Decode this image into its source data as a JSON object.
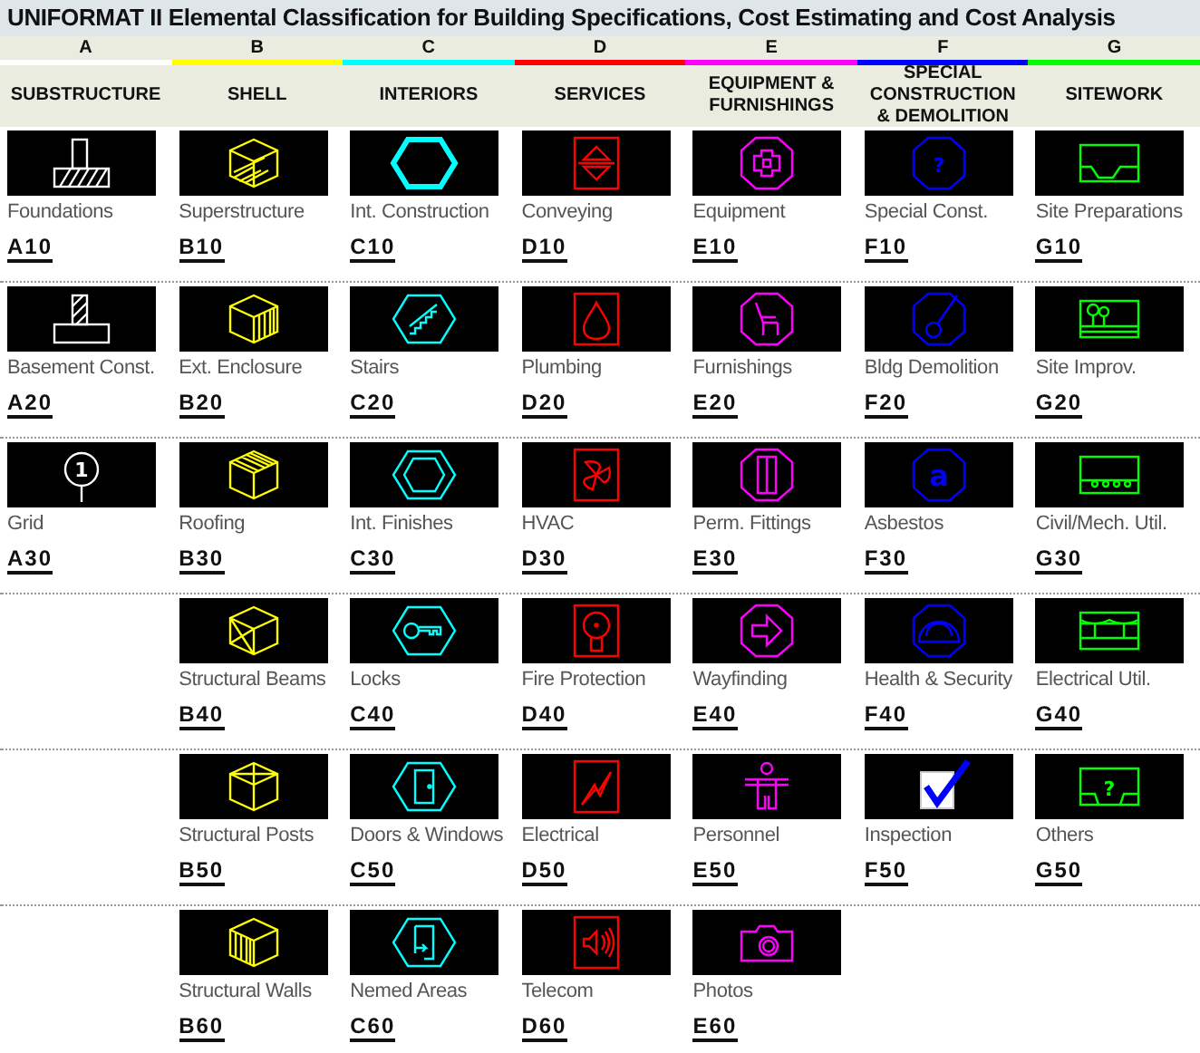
{
  "title": "UNIFORMAT II Elemental Classification for Building Specifications, Cost Estimating and Cost Analysis",
  "columns": [
    {
      "letter": "A",
      "heading": "SUBSTRUCTURE",
      "color": "#ffffff",
      "items": [
        {
          "label": "Foundations",
          "code": "A10"
        },
        {
          "label": "Basement Const.",
          "code": "A20"
        },
        {
          "label": "Grid",
          "code": "A30",
          "icon_text": "1"
        }
      ]
    },
    {
      "letter": "B",
      "heading": "SHELL",
      "color": "#ffff00",
      "items": [
        {
          "label": "Superstructure",
          "code": "B10"
        },
        {
          "label": "Ext. Enclosure",
          "code": "B20"
        },
        {
          "label": "Roofing",
          "code": "B30"
        },
        {
          "label": "Structural Beams",
          "code": "B40"
        },
        {
          "label": "Structural Posts",
          "code": "B50"
        },
        {
          "label": "Structural Walls",
          "code": "B60"
        }
      ]
    },
    {
      "letter": "C",
      "heading": "INTERIORS",
      "color": "#00ffff",
      "items": [
        {
          "label": "Int. Construction",
          "code": "C10"
        },
        {
          "label": "Stairs",
          "code": "C20"
        },
        {
          "label": "Int. Finishes",
          "code": "C30"
        },
        {
          "label": "Locks",
          "code": "C40"
        },
        {
          "label": "Doors & Windows",
          "code": "C50"
        },
        {
          "label": "Nemed Areas",
          "code": "C60"
        }
      ]
    },
    {
      "letter": "D",
      "heading": "SERVICES",
      "color": "#ff0000",
      "items": [
        {
          "label": "Conveying",
          "code": "D10"
        },
        {
          "label": "Plumbing",
          "code": "D20"
        },
        {
          "label": "HVAC",
          "code": "D30"
        },
        {
          "label": "Fire Protection",
          "code": "D40"
        },
        {
          "label": "Electrical",
          "code": "D50"
        },
        {
          "label": "Telecom",
          "code": "D60"
        }
      ]
    },
    {
      "letter": "E",
      "heading": "EQUIPMENT & FURNISHINGS",
      "color": "#ff00ff",
      "items": [
        {
          "label": "Equipment",
          "code": "E10"
        },
        {
          "label": "Furnishings",
          "code": "E20"
        },
        {
          "label": "Perm. Fittings",
          "code": "E30"
        },
        {
          "label": "Wayfinding",
          "code": "E40"
        },
        {
          "label": "Personnel",
          "code": "E50"
        },
        {
          "label": "Photos",
          "code": "E60"
        }
      ]
    },
    {
      "letter": "F",
      "heading": "SPECIAL CONSTRUCTION & DEMOLITION",
      "color": "#0000ff",
      "items": [
        {
          "label": "Special Const.",
          "code": "F10",
          "icon_text": "?"
        },
        {
          "label": "Bldg Demolition",
          "code": "F20"
        },
        {
          "label": "Asbestos",
          "code": "F30",
          "icon_text": "a"
        },
        {
          "label": "Health & Security",
          "code": "F40"
        },
        {
          "label": "Inspection",
          "code": "F50"
        }
      ]
    },
    {
      "letter": "G",
      "heading": "SITEWORK",
      "color": "#00ff00",
      "items": [
        {
          "label": "Site Preparations",
          "code": "G10"
        },
        {
          "label": "Site Improv.",
          "code": "G20"
        },
        {
          "label": "Civil/Mech. Util.",
          "code": "G30"
        },
        {
          "label": "Electrical Util.",
          "code": "G40"
        },
        {
          "label": "Others",
          "code": "G50",
          "icon_text": "?"
        }
      ]
    }
  ]
}
